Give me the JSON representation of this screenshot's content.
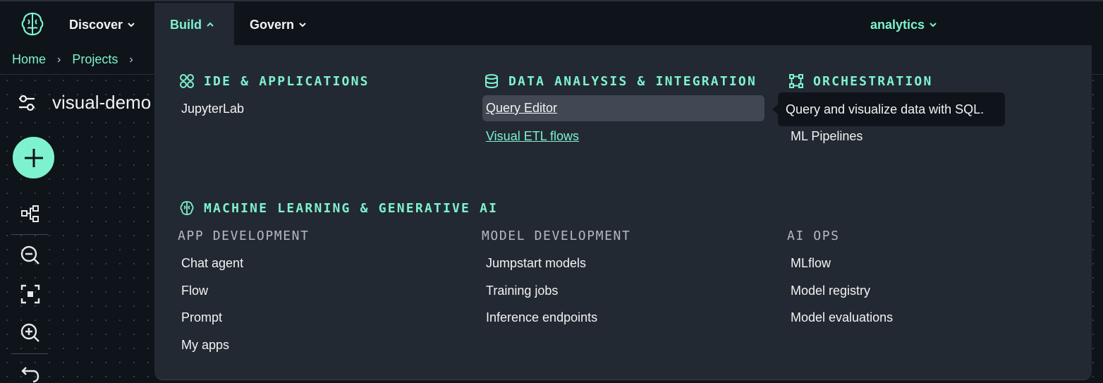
{
  "topnav": {
    "items": [
      {
        "label": "Discover"
      },
      {
        "label": "Build"
      },
      {
        "label": "Govern"
      }
    ],
    "project_switcher": "analytics"
  },
  "breadcrumb": [
    "Home",
    "Projects"
  ],
  "project": {
    "title": "visual-demo"
  },
  "menu": {
    "ide": {
      "title": "IDE & APPLICATIONS",
      "icon": "grid-circles-icon",
      "items": [
        "JupyterLab"
      ]
    },
    "data": {
      "title": "DATA ANALYSIS & INTEGRATION",
      "icon": "database-icon",
      "items": [
        "Query Editor",
        "Visual ETL flows"
      ]
    },
    "orchestration": {
      "title": "ORCHESTRATION",
      "icon": "workflow-icon",
      "items": [
        "ML Pipelines"
      ]
    },
    "ml": {
      "title": "MACHINE LEARNING & GENERATIVE AI",
      "icon": "brain-icon",
      "app_dev": {
        "title": "APP DEVELOPMENT",
        "items": [
          "Chat agent",
          "Flow",
          "Prompt",
          "My apps"
        ]
      },
      "model_dev": {
        "title": "MODEL DEVELOPMENT",
        "items": [
          "Jumpstart models",
          "Training jobs",
          "Inference endpoints"
        ]
      },
      "ai_ops": {
        "title": "AI OPS",
        "items": [
          "MLflow",
          "Model registry",
          "Model evaluations"
        ]
      }
    }
  },
  "tooltip": "Query and visualize data with SQL.",
  "colors": {
    "accent": "#7ef2cf",
    "panel": "#232932",
    "background": "#0f141a"
  }
}
